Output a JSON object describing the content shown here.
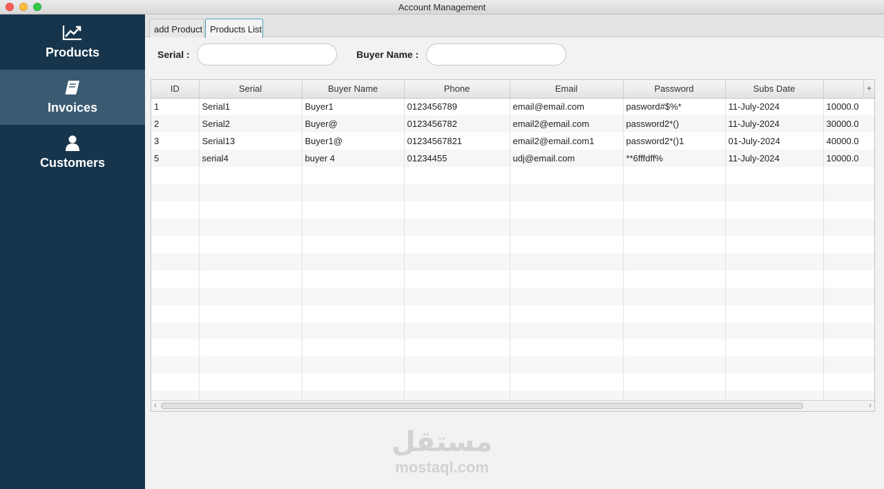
{
  "window": {
    "title": "Account Management"
  },
  "sidebar": {
    "items": [
      {
        "label": "Products",
        "icon": "chart-line-icon",
        "active": false
      },
      {
        "label": "Invoices",
        "icon": "book-icon",
        "active": true
      },
      {
        "label": "Customers",
        "icon": "user-icon",
        "active": false
      }
    ]
  },
  "tabs": [
    {
      "label": "add Product",
      "active": false
    },
    {
      "label": "Products List",
      "active": true
    }
  ],
  "search": {
    "serial_label": "Serial :",
    "serial_value": "",
    "buyer_label": "Buyer Name :",
    "buyer_value": ""
  },
  "table": {
    "columns": [
      "ID",
      "Serial",
      "Buyer Name",
      "Phone",
      "Email",
      "Password",
      "Subs Date",
      ""
    ],
    "rows": [
      [
        "1",
        "Serial1",
        "Buyer1",
        "0123456789",
        "email@email.com",
        "pasword#$%*",
        "11-July-2024",
        "10000.0"
      ],
      [
        "2",
        "Serial2",
        "Buyer@",
        "0123456782",
        "email2@email.com",
        "password2*()",
        "11-July-2024",
        "30000.0"
      ],
      [
        "3",
        "Serial13",
        "Buyer1@",
        "01234567821",
        "email2@email.com1",
        "password2*()1",
        "01-July-2024",
        "40000.0"
      ],
      [
        "5",
        "serial4",
        "buyer 4",
        "01234455",
        "udj@email.com",
        "**6fffdff%",
        "11-July-2024",
        "10000.0"
      ]
    ],
    "plus_label": "+"
  },
  "watermark": {
    "arabic": "مستقل",
    "latin": "mostaql.com"
  },
  "colors": {
    "sidebar": "#16354d",
    "sidebar_active": "#3a5a72",
    "tab_active_border": "#3fa0b8"
  }
}
